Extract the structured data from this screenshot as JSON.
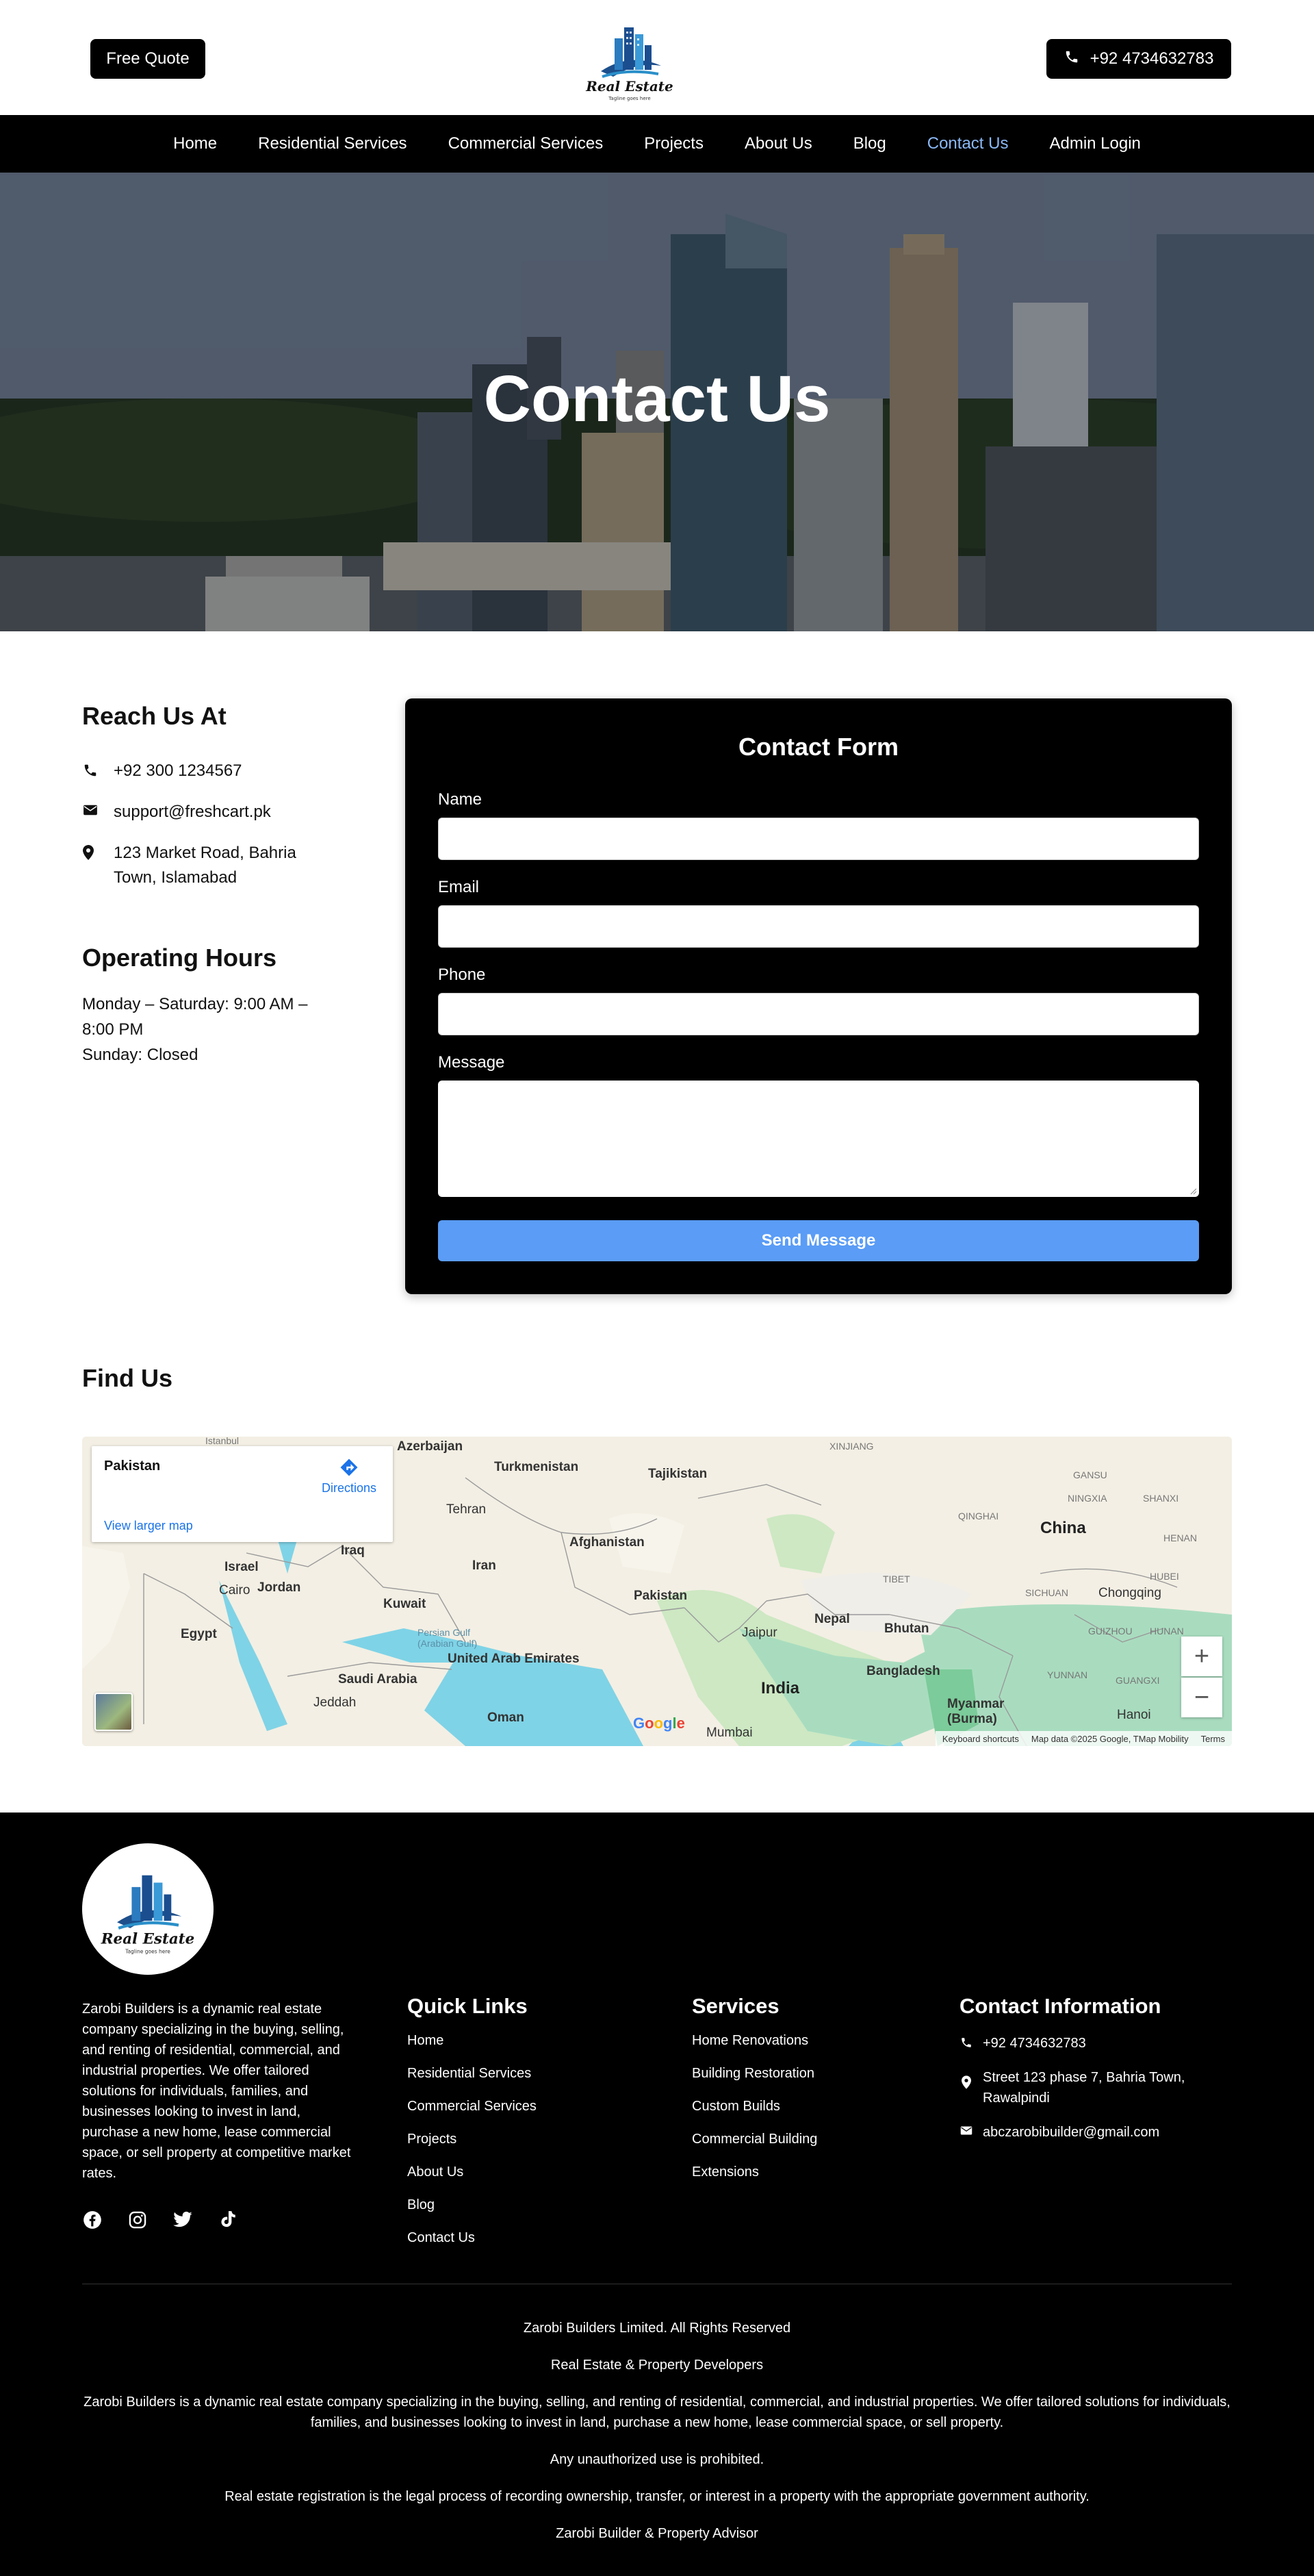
{
  "header": {
    "quote_label": "Free Quote",
    "phone_label": "+92 4734632783",
    "logo_text": "Real Estate",
    "logo_tagline": "Tagline goes here"
  },
  "nav": {
    "items": [
      {
        "label": "Home"
      },
      {
        "label": "Residential Services"
      },
      {
        "label": "Commercial Services"
      },
      {
        "label": "Projects"
      },
      {
        "label": "About Us"
      },
      {
        "label": "Blog"
      },
      {
        "label": "Contact Us",
        "active": true
      },
      {
        "label": "Admin Login"
      }
    ],
    "active_color": "#8ab8f5"
  },
  "hero": {
    "title": "Contact Us"
  },
  "reach": {
    "title": "Reach Us At",
    "phone": "+92 300 1234567",
    "email": "support@freshcart.pk",
    "address_line1": "123 Market Road, Bahria",
    "address_line2": "Town, Islamabad"
  },
  "hours": {
    "title": "Operating Hours",
    "line1": "Monday – Saturday: 9:00 AM –",
    "line2": "8:00 PM",
    "line3": "Sunday: Closed"
  },
  "form": {
    "title": "Contact Form",
    "name_label": "Name",
    "email_label": "Email",
    "phone_label": "Phone",
    "message_label": "Message",
    "send_label": "Send Message",
    "send_color": "#5a9cf6"
  },
  "map": {
    "title": "Find Us",
    "place": "Pakistan",
    "directions": "Directions",
    "larger_map": "View larger map",
    "labels": {
      "china": "China",
      "pakistan": "Pakistan",
      "india": "India",
      "afghanistan": "Afghanistan",
      "iran": "Iran",
      "iraq": "Iraq",
      "turkmenistan": "Turkmenistan",
      "tajikistan": "Tajikistan",
      "azerbaijan": "Azerbaijan",
      "kuwait": "Kuwait",
      "saudi": "Saudi Arabia",
      "uae": "United Arab Emirates",
      "oman": "Oman",
      "egypt": "Egypt",
      "jordan": "Jordan",
      "israel": "Israel",
      "nepal": "Nepal",
      "bhutan": "Bhutan",
      "bangladesh": "Bangladesh",
      "myanmar": "Myanmar (Burma)",
      "cairo": "Cairo",
      "tehran": "Tehran",
      "jeddah": "Jeddah",
      "mumbai": "Mumbai",
      "jaipur": "Jaipur",
      "chongqing": "Chongqing",
      "hanoi": "Hanoi",
      "xinjiang": "XINJIANG",
      "qinghai": "QINGHAI",
      "tibet": "TIBET",
      "gansu": "GANSU",
      "sichuan": "SICHUAN",
      "yunnan": "YUNNAN",
      "hubei": "HUBEI",
      "henan": "HENAN",
      "shanxi": "SHANXI",
      "ningxia": "NINGXIA",
      "guizhou": "GUIZHOU",
      "hunan": "HUNAN",
      "guangxi": "GUANGXI",
      "persian_gulf": "Persian Gulf",
      "arabian_gulf": "(Arabian Gulf)",
      "istanbul": "İstanbul"
    },
    "keyboard": "Keyboard shortcuts",
    "mapdata": "Map data ©2025 Google, TMap Mobility",
    "terms": "Terms",
    "zoom_in": "+",
    "zoom_out": "−",
    "google": "Google"
  },
  "footer": {
    "about": "Zarobi Builders is a dynamic real estate company specializing in the buying, selling, and renting of residential, commercial, and industrial properties. We offer tailored solutions for individuals, families, and businesses looking to invest in land, purchase a new home, lease commercial space, or sell property at competitive market rates.",
    "quick_title": "Quick Links",
    "quick_links": [
      "Home",
      "Residential Services",
      "Commercial Services",
      "Projects",
      "About Us",
      "Blog",
      "Contact Us"
    ],
    "services_title": "Services",
    "services": [
      "Home Renovations",
      "Building Restoration",
      "Custom Builds",
      "Commercial Building",
      "Extensions"
    ],
    "contact_title": "Contact Information",
    "contact_phone": "+92 4734632783",
    "contact_address": "Street 123 phase 7, Bahria Town, Rawalpindi",
    "contact_email": "abczarobibuilder@gmail.com",
    "rights": "Zarobi Builders Limited. All Rights Reserved",
    "tagline": "Real Estate & Property Developers",
    "desc": "Zarobi Builders is a dynamic real estate company specializing in the buying, selling, and renting of residential, commercial, and industrial properties. We offer tailored solutions for individuals, families, and businesses looking to invest in land, purchase a new home, lease commercial space, or sell property.",
    "unauth": "Any unauthorized use is prohibited.",
    "registration": "Real estate registration is the legal process of recording ownership, transfer, or interest in a property with the appropriate government authority.",
    "advisor": "Zarobi Builder & Property Advisor"
  }
}
